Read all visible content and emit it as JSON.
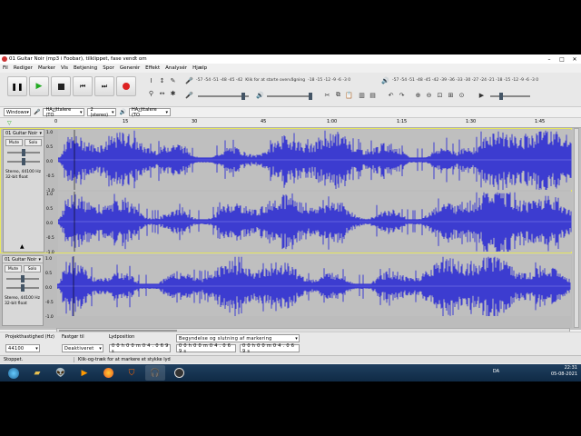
{
  "window": {
    "title": "01 Guitar Noir (mp3 i Foobar), tilklippet, fase vendt om"
  },
  "menu": [
    "Fil",
    "Rediger",
    "Marker",
    "Vis",
    "Betjening",
    "Spor",
    "Generér",
    "Effekt",
    "Analysér",
    "Hjælp"
  ],
  "meters": {
    "record_scale": "-57 -54 -51 -48 -45 -42",
    "record_prompt": "Klik for at starte overvågning",
    "record_scale2": "-18 -15 -12 -9 -6 -3 0",
    "play_scale": "-57 -54 -51 -48 -45 -42 -39 -36 -33 -30 -27 -24 -21 -18 -15 -12 -9 -6 -3 0"
  },
  "devices": {
    "host": "Windows",
    "record_device": "HÃ¿jttalere (TO",
    "channels": "2 (stereo)",
    "play_device": "HÃ¿jttalere (TO"
  },
  "ruler": {
    "ticks": [
      "0",
      "15",
      "30",
      "45",
      "1:00",
      "1:15",
      "1:30",
      "1:45"
    ]
  },
  "tracks": [
    {
      "name": "01 Guitar Noir",
      "mute": "Mute",
      "solo": "Solo",
      "info": [
        "Stereo, 44100 Hz",
        "32-bit float"
      ],
      "scale": [
        "1.0",
        "0.5",
        "0.0",
        "-0.5",
        "-1.0"
      ]
    },
    {
      "name": "01 Guitar Noir",
      "mute": "Mute",
      "solo": "Solo",
      "info": [
        "Stereo, 44100 Hz",
        "32-bit float"
      ],
      "scale": [
        "1.0",
        "0.5",
        "0.0",
        "-0.5",
        "-1.0"
      ]
    }
  ],
  "selection": {
    "rate_label": "Projekthastighed (Hz)",
    "rate_value": "44100",
    "snap_label": "Fastgør til",
    "snap_value": "Deaktiveret",
    "audio_pos_label": "Lydposition",
    "audio_pos_value": "0 0 h 0 0 m 0 4 . 0 6 9 s",
    "sel_mode": "Begyndelse og slutning af markering",
    "sel_start": "0 0 h 0 0 m 0 4 . 0 6 9 s",
    "sel_end": "0 0 h 0 0 m 0 4 . 0 6 9 s"
  },
  "status": {
    "left": "Stoppet.",
    "hint": "Klik-og-træk for at markere et stykke lyd"
  },
  "taskbar": {
    "lang": "DA",
    "time": "22:31",
    "date": "05-08-2021"
  },
  "colors": {
    "wave": "#3c3cd0",
    "wave_bg": "#bfbfbf",
    "selected_border": "#e8e860"
  }
}
